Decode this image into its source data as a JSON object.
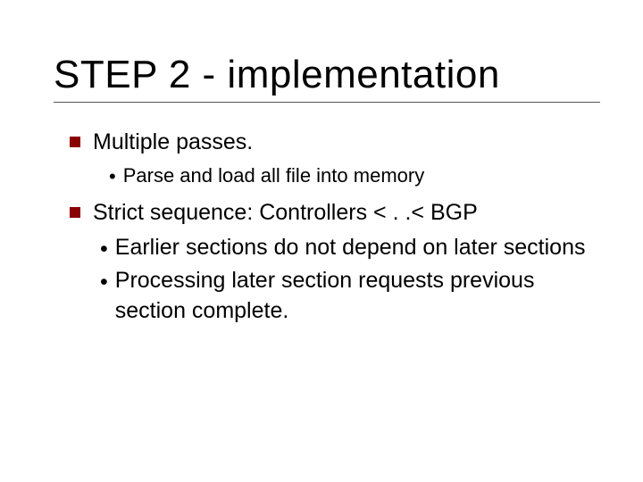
{
  "title": "STEP 2 - implementation",
  "items": [
    {
      "text": "Multiple passes.",
      "sub": [
        {
          "text": "Parse and load all file into memory"
        }
      ]
    },
    {
      "text": "Strict sequence: Controllers < . .< BGP",
      "sub_big": [
        {
          "text": "Earlier sections do not depend on later sections"
        },
        {
          "text": "Processing later section requests previous section complete."
        }
      ]
    }
  ]
}
